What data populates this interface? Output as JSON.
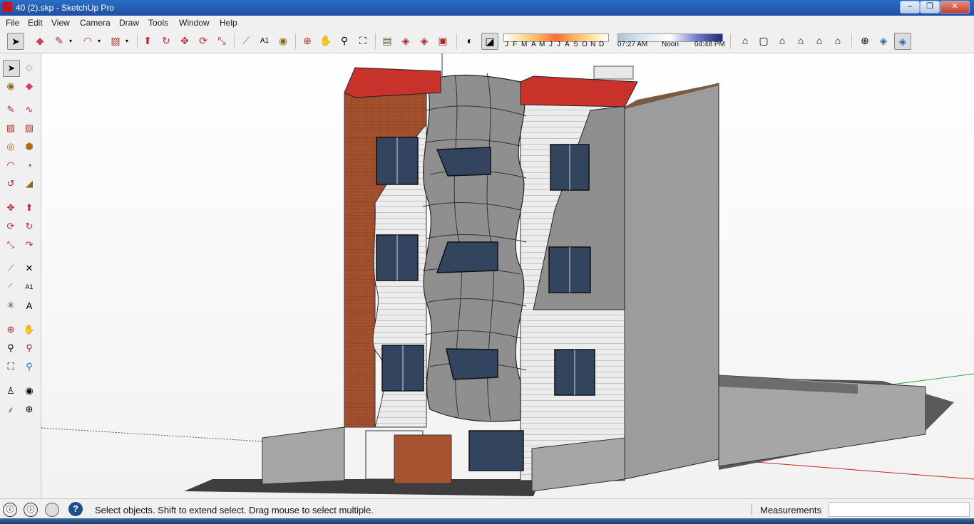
{
  "window": {
    "title": "40 (2).skp - SketchUp Pro"
  },
  "window_buttons": {
    "minimize": "–",
    "restore": "❐",
    "close": "✕"
  },
  "menu": [
    "File",
    "Edit",
    "View",
    "Camera",
    "Draw",
    "Tools",
    "Window",
    "Help"
  ],
  "shadow_settings": {
    "months": [
      "J",
      "F",
      "M",
      "A",
      "M",
      "J",
      "J",
      "A",
      "S",
      "O",
      "N",
      "D"
    ],
    "time_start": "07:27 AM",
    "time_noon": "Noon",
    "time_end": "04:48 PM"
  },
  "status": {
    "hint": "Select objects. Shift to extend select. Drag mouse to select multiple.",
    "measurements_label": "Measurements",
    "measurements_value": ""
  },
  "colors": {
    "titlebar": "#1d4fa3",
    "roof": "#c9312b",
    "brick": "#a8532f",
    "siding": "#e9e9e9",
    "facade_panel": "#8f8f8f",
    "window_glass": "#33445e",
    "side_wall": "#9c9c9c",
    "ground_shadow": "#4a4a4a"
  },
  "icons": {
    "toolbar": [
      "select-icon",
      "eraser-icon",
      "pencil-icon",
      "arc-icon",
      "rectangle-icon",
      "push-pull-icon",
      "follow-me-icon",
      "move-icon",
      "rotate-icon",
      "scale-icon",
      "tape-measure-icon",
      "text-icon",
      "paint-bucket-icon",
      "orbit-icon",
      "pan-icon",
      "zoom-icon",
      "zoom-extents-icon",
      "components-icon",
      "materials-icon",
      "styles-icon",
      "scenes-icon",
      "shadows-icon",
      "fog-icon",
      "iso-view-icon",
      "top-view-icon",
      "front-view-icon",
      "right-view-icon",
      "back-view-icon",
      "left-view-icon",
      "xray-icon",
      "back-edges-icon",
      "shaded-icon"
    ],
    "left": [
      "select-icon",
      "make-component-icon",
      "paint-bucket-icon",
      "eraser-icon",
      "pencil-icon",
      "freehand-icon",
      "rectangle-icon",
      "rotated-rectangle-icon",
      "circle-icon",
      "polygon-icon",
      "arc-icon",
      "pie-icon",
      "three-point-arc-icon",
      "two-point-arc-icon",
      "move-icon",
      "push-pull-icon",
      "rotate-icon",
      "follow-me-icon",
      "scale-icon",
      "offset-icon",
      "tape-measure-icon",
      "dimension-icon",
      "protractor-icon",
      "text-icon",
      "axes-icon",
      "3d-text-icon",
      "orbit-icon",
      "pan-icon",
      "zoom-icon",
      "zoom-window-icon",
      "zoom-extents-icon",
      "previous-view-icon",
      "position-camera-icon",
      "look-around-icon",
      "walk-icon",
      "section-plane-icon"
    ]
  }
}
